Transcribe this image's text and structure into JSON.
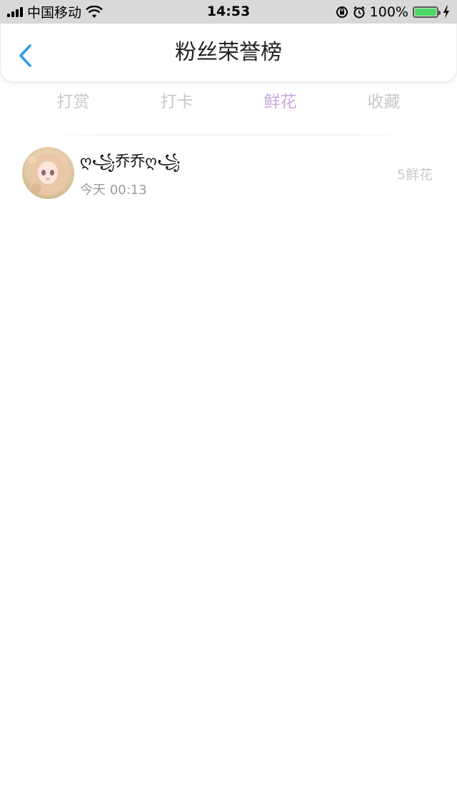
{
  "status_bar": {
    "carrier": "中国移动",
    "time": "14:53",
    "battery_percent": "100%",
    "battery_level": 1.0,
    "battery_color": "#4cd964",
    "icons": [
      "signal-icon",
      "wifi-icon",
      "orientation-lock-icon",
      "alarm-icon",
      "battery-icon",
      "charging-icon"
    ]
  },
  "nav": {
    "title": "粉丝荣誉榜",
    "back_icon": "chevron-left-icon",
    "accent_color": "#2f9be8"
  },
  "tabs": [
    {
      "label": "打赏",
      "active": false
    },
    {
      "label": "打卡",
      "active": false
    },
    {
      "label": "鲜花",
      "active": true
    },
    {
      "label": "收藏",
      "active": false
    }
  ],
  "colors": {
    "tab_active": "#c9a6df",
    "tab_inactive": "#c8c8c8"
  },
  "list": [
    {
      "name": "ღ꧁乔乔ღ꧁",
      "time": "今天 00:13",
      "amount": "5鲜花"
    }
  ]
}
